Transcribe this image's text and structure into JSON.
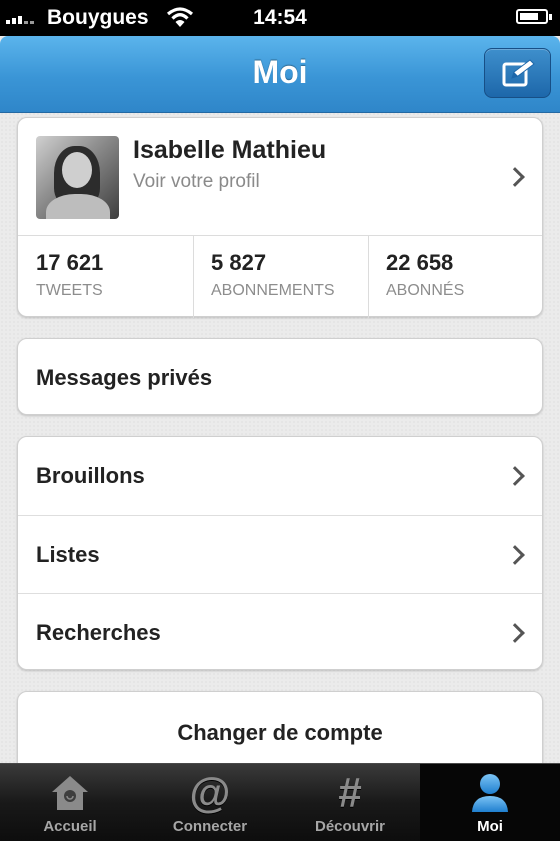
{
  "status_bar": {
    "carrier": "Bouygues",
    "time": "14:54",
    "icons": [
      "signal-icon",
      "wifi-icon",
      "battery-icon"
    ]
  },
  "nav": {
    "title": "Moi",
    "compose_icon": "compose-icon"
  },
  "profile": {
    "name": "Isabelle Mathieu",
    "subtitle": "Voir votre profil",
    "stats": [
      {
        "value": "17 621",
        "label": "TWEETS"
      },
      {
        "value": "5 827",
        "label": "ABONNEMENTS"
      },
      {
        "value": "22 658",
        "label": "ABONNÉS"
      }
    ]
  },
  "messages": {
    "label": "Messages privés"
  },
  "lists": [
    {
      "label": "Brouillons"
    },
    {
      "label": "Listes"
    },
    {
      "label": "Recherches"
    }
  ],
  "switch_account": {
    "label": "Changer de compte"
  },
  "tabbar": {
    "active": "Moi",
    "tabs": [
      {
        "label": "Accueil",
        "icon": "home-icon"
      },
      {
        "label": "Connecter",
        "icon": "at-icon"
      },
      {
        "label": "Découvrir",
        "icon": "hash-icon"
      },
      {
        "label": "Moi",
        "icon": "person-icon"
      }
    ]
  },
  "colors": {
    "nav_blue": "#3a95d6",
    "active_tab_icon": "#3b9be0"
  }
}
